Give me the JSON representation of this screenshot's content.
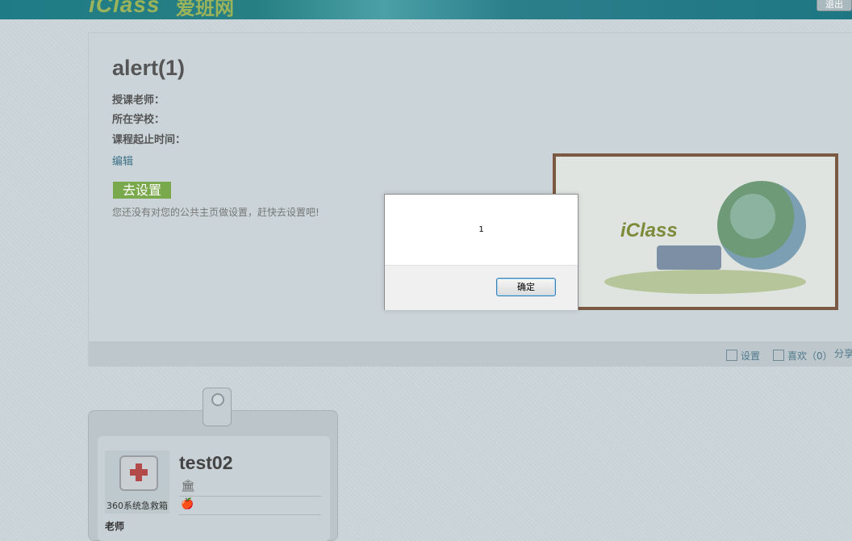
{
  "header": {
    "logo_text": "iClass",
    "logo_cn": "爱班网",
    "logout_label": "退出"
  },
  "course": {
    "title": "alert(1)",
    "teacher_label": "授课老师：",
    "school_label": "所在学校：",
    "period_label": "课程起止时间：",
    "edit_label": "编辑",
    "setting_button": "去设置",
    "setting_hint": "您还没有对您的公共主页做设置，赶快去设置吧!",
    "footer": {
      "settings_label": "设置",
      "like_label": "喜欢（0）",
      "share_label": "分享"
    },
    "banner_text": "iClass"
  },
  "profile": {
    "avatar_caption": "360系统急救箱",
    "username": "test02",
    "school_icon": "🏛",
    "apple_icon": "🍎",
    "role": "老师"
  },
  "dialog": {
    "message": "1",
    "ok_label": "确定"
  }
}
